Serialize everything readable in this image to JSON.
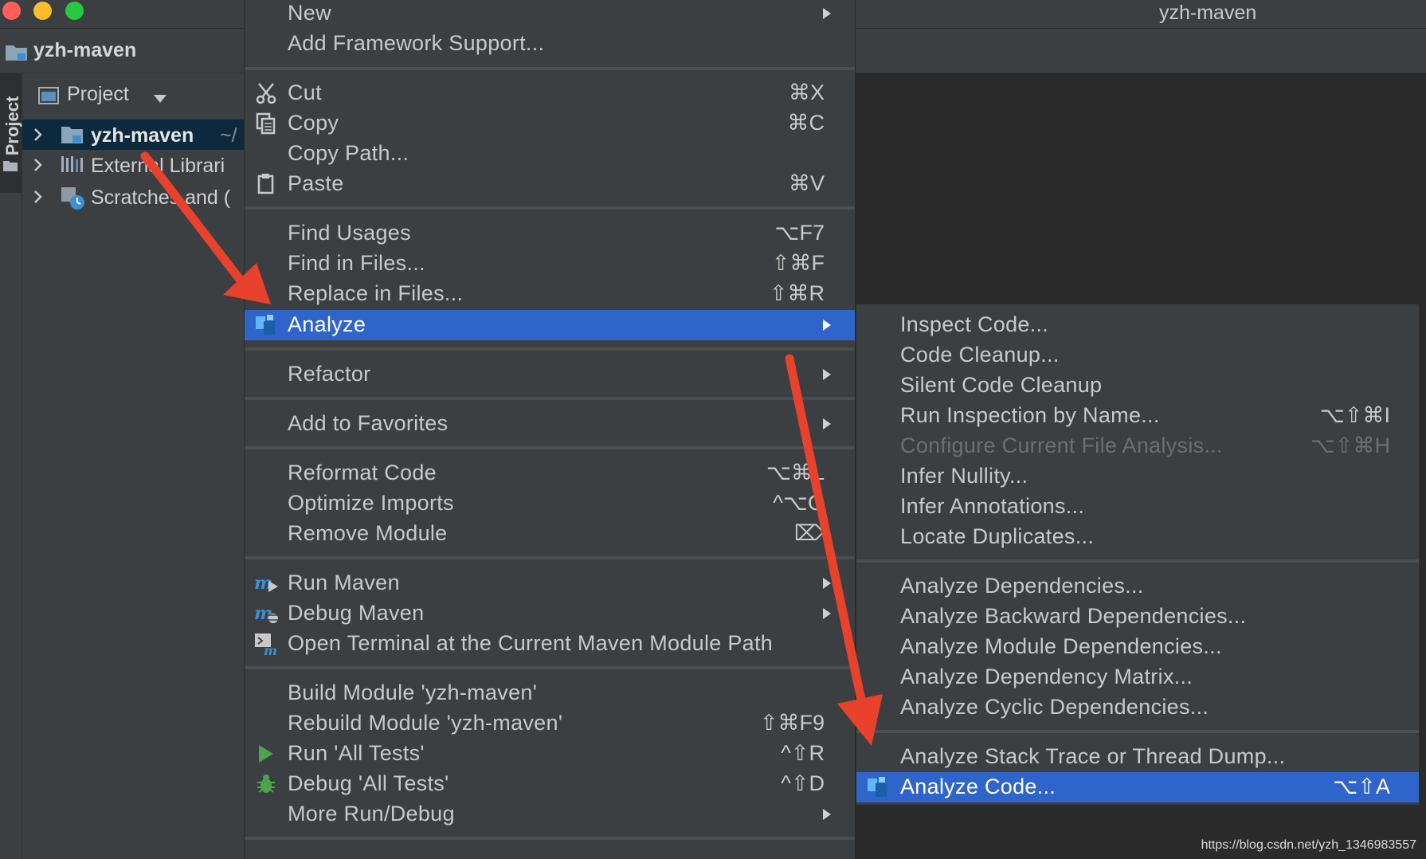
{
  "window": {
    "title": "yzh-maven"
  },
  "navbar": {
    "label": "yzh-maven"
  },
  "toolstrip": {
    "project_label": "Project"
  },
  "project_panel": {
    "title": "Project",
    "tree": [
      {
        "label": "yzh-maven",
        "path": "~/",
        "icon": "module-folder-icon",
        "selected": true
      },
      {
        "label": "External Librari",
        "icon": "libraries-icon",
        "selected": false
      },
      {
        "label": "Scratches and (",
        "icon": "scratches-icon",
        "selected": false
      }
    ]
  },
  "context_menu": {
    "items": [
      {
        "label": "New",
        "submenu": true
      },
      {
        "label": "Add Framework Support..."
      },
      {
        "label": "Cut",
        "shortcut": "⌘X",
        "icon": "scissors-icon"
      },
      {
        "label": "Copy",
        "shortcut": "⌘C",
        "icon": "copy-icon"
      },
      {
        "label": "Copy Path..."
      },
      {
        "label": "Paste",
        "shortcut": "⌘V",
        "icon": "clipboard-icon"
      },
      {
        "label": "Find Usages",
        "shortcut": "⌥F7"
      },
      {
        "label": "Find in Files...",
        "shortcut": "⇧⌘F"
      },
      {
        "label": "Replace in Files...",
        "shortcut": "⇧⌘R"
      },
      {
        "label": "Analyze",
        "submenu": true,
        "highlighted": true,
        "icon": "analyze-icon"
      },
      {
        "label": "Refactor",
        "submenu": true
      },
      {
        "label": "Add to Favorites",
        "submenu": true
      },
      {
        "label": "Reformat Code",
        "shortcut": "⌥⌘L"
      },
      {
        "label": "Optimize Imports",
        "shortcut": "^⌥O"
      },
      {
        "label": "Remove Module",
        "shortcut": "⌦"
      },
      {
        "label": "Run Maven",
        "submenu": true,
        "icon": "run-maven-icon"
      },
      {
        "label": "Debug Maven",
        "submenu": true,
        "icon": "debug-maven-icon"
      },
      {
        "label": "Open Terminal at the Current Maven Module Path",
        "icon": "terminal-maven-icon"
      },
      {
        "label": "Build Module 'yzh-maven'"
      },
      {
        "label": "Rebuild Module 'yzh-maven'",
        "shortcut": "⇧⌘F9"
      },
      {
        "label": "Run 'All Tests'",
        "shortcut": "^⇧R",
        "icon": "run-icon"
      },
      {
        "label": "Debug 'All Tests'",
        "shortcut": "^⇧D",
        "icon": "debug-icon"
      },
      {
        "label": "More Run/Debug",
        "submenu": true
      }
    ]
  },
  "analyze_submenu": {
    "items": [
      {
        "label": "Inspect Code..."
      },
      {
        "label": "Code Cleanup..."
      },
      {
        "label": "Silent Code Cleanup"
      },
      {
        "label": "Run Inspection by Name...",
        "shortcut": "⌥⇧⌘I"
      },
      {
        "label": "Configure Current File Analysis...",
        "shortcut": "⌥⇧⌘H",
        "disabled": true
      },
      {
        "label": "Infer Nullity..."
      },
      {
        "label": "Infer Annotations..."
      },
      {
        "label": "Locate Duplicates..."
      },
      {
        "label": "Analyze Dependencies..."
      },
      {
        "label": "Analyze Backward Dependencies..."
      },
      {
        "label": "Analyze Module Dependencies..."
      },
      {
        "label": "Analyze Dependency Matrix..."
      },
      {
        "label": "Analyze Cyclic Dependencies..."
      },
      {
        "label": "Analyze Stack Trace or Thread Dump..."
      },
      {
        "label": "Analyze Code...",
        "shortcut": "⌥⇧A",
        "highlighted": true,
        "icon": "analyze-icon"
      }
    ]
  },
  "watermark": "https://blog.csdn.net/yzh_1346983557",
  "colors": {
    "menu_bg": "#3c3f41",
    "highlight": "#2f65ca",
    "tree_selection": "#0d293e",
    "annotation_arrow": "#e8412c"
  }
}
